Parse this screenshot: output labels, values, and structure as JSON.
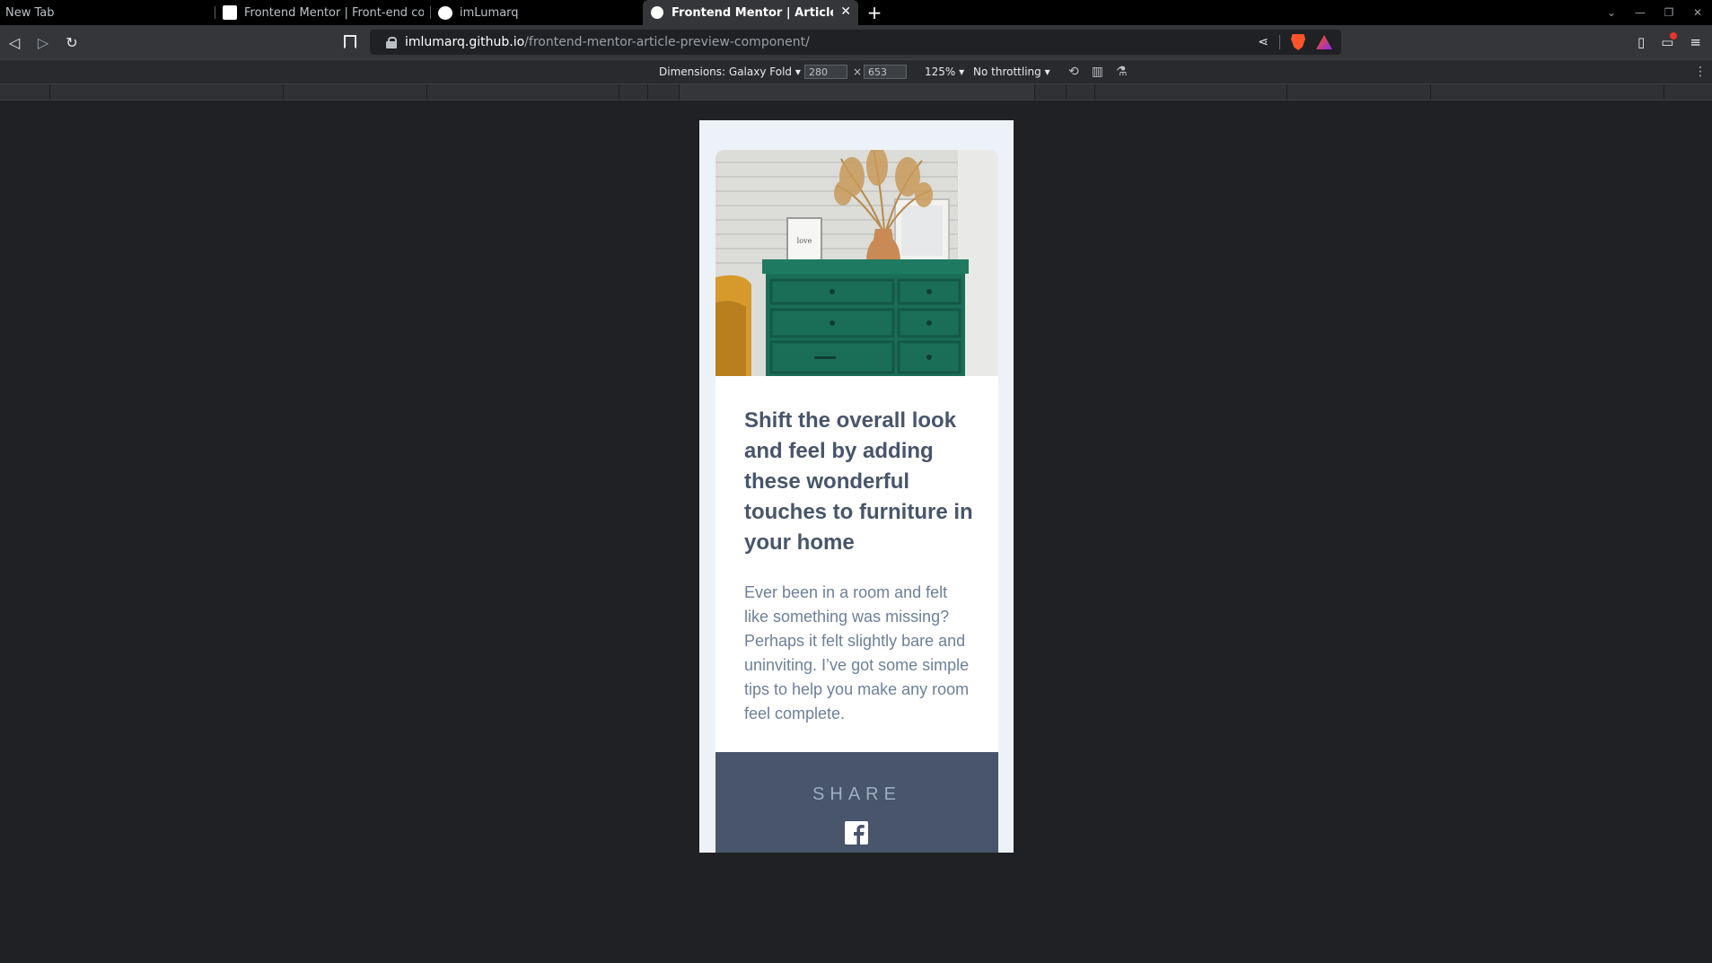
{
  "browser": {
    "tabs": [
      {
        "title": "New Tab",
        "icon": "none",
        "active": false
      },
      {
        "title": "Frontend Mentor | Front-end codi",
        "icon": "frontend-mentor-icon",
        "active": false
      },
      {
        "title": "imLumarq",
        "icon": "github-icon",
        "active": false
      },
      {
        "title": "Frontend Mentor | Article Previ",
        "icon": "globe-icon",
        "active": true
      }
    ],
    "new_tab_symbol": "+",
    "close_symbol": "✕",
    "url": {
      "host": "imlumarq.github.io",
      "path": "/frontend-mentor-article-preview-component/"
    },
    "brave_badge_count": "1"
  },
  "device_toolbar": {
    "dimensions_label": "Dimensions: Galaxy Fold ▾",
    "width": "280",
    "times": "×",
    "height": "653",
    "zoom": "125% ▾",
    "throttling": "No throttling ▾"
  },
  "article": {
    "headline": "Shift the overall look and feel by adding these wonderful touches to furniture in your home",
    "description": "Ever been in a room and felt like something was missing? Perhaps it felt slightly bare and uninviting. I’ve got some simple tips to help you make any room feel complete.",
    "share_label": "SHARE",
    "colors": {
      "page_bg": "#ecf2f8",
      "heading": "#48556a",
      "body_text": "#6e8098",
      "share_bar": "#48556a",
      "share_label": "#9eafc2"
    }
  }
}
